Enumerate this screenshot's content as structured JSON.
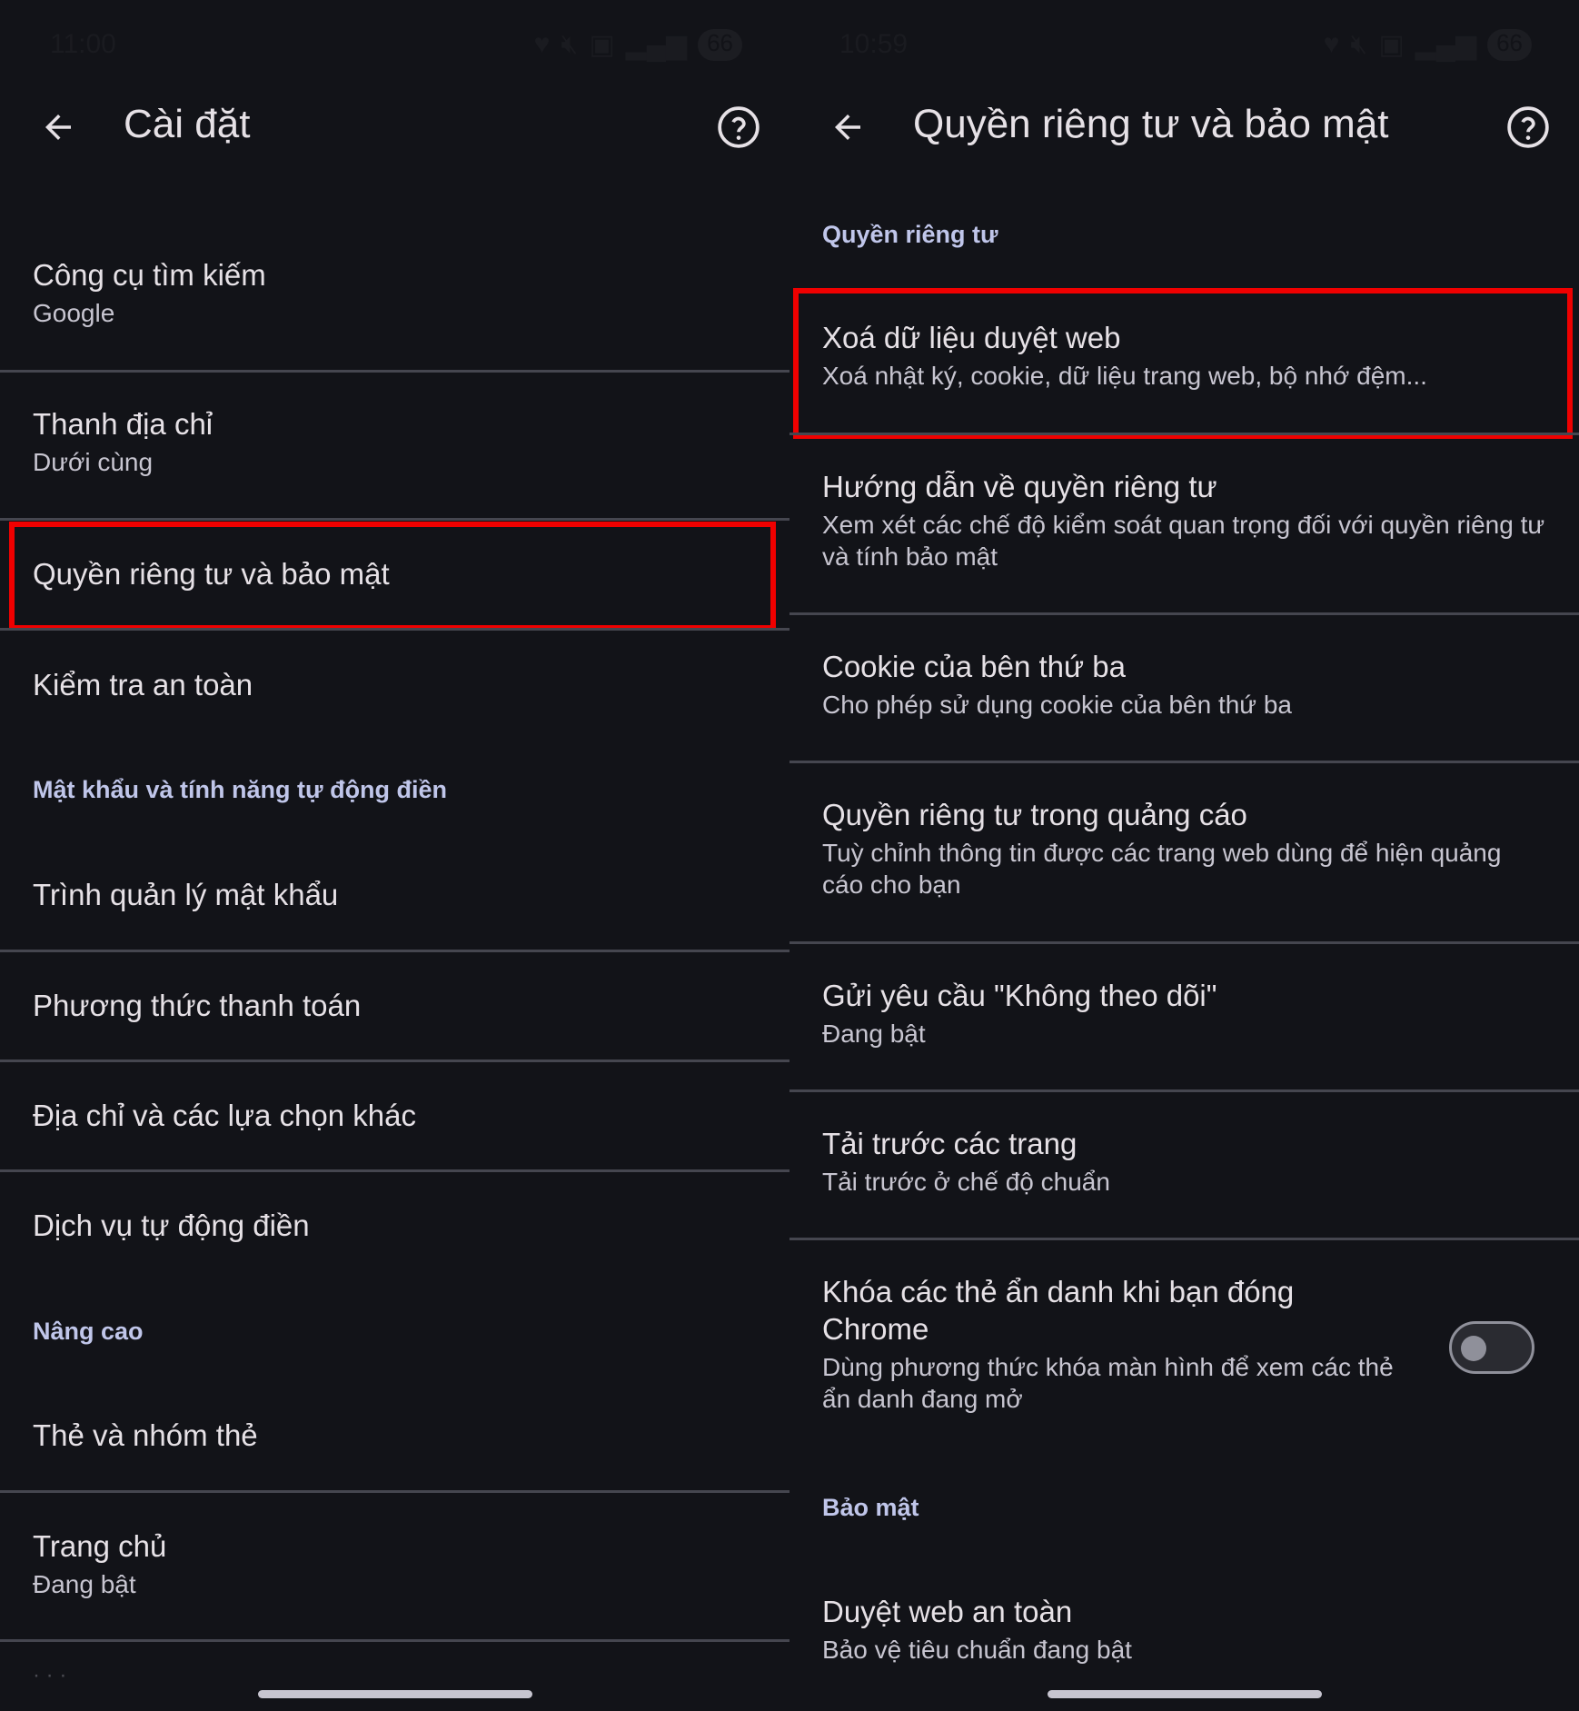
{
  "left": {
    "status": {
      "time": "11:00",
      "battery": "66"
    },
    "title": "Cài đặt",
    "items": [
      {
        "title": "Công cụ tìm kiếm",
        "subtitle": "Google"
      },
      {
        "title": "Thanh địa chỉ",
        "subtitle": "Dưới cùng"
      },
      {
        "title": "Quyền riêng tư và bảo mật"
      },
      {
        "title": "Kiểm tra an toàn"
      },
      {
        "title": "Trình quản lý mật khẩu"
      },
      {
        "title": "Phương thức thanh toán"
      },
      {
        "title": "Địa chỉ và các lựa chọn khác"
      },
      {
        "title": "Dịch vụ tự động điền"
      },
      {
        "title": "Thẻ và nhóm thẻ"
      },
      {
        "title": "Trang chủ",
        "subtitle": "Đang bật"
      }
    ],
    "sections": {
      "passwords": "Mật khẩu và tính năng tự động điền",
      "advanced": "Nâng cao"
    },
    "partial_text": "· ·  ·"
  },
  "right": {
    "status": {
      "time": "10:59",
      "battery": "66"
    },
    "title": "Quyền riêng tư và bảo mật",
    "sections": {
      "privacy": "Quyền riêng tư",
      "security": "Bảo mật"
    },
    "items": [
      {
        "title": "Xoá dữ liệu duyệt web",
        "subtitle": "Xoá nhật ký, cookie, dữ liệu trang web, bộ nhớ đệm..."
      },
      {
        "title": "Hướng dẫn về quyền riêng tư",
        "subtitle": "Xem xét các chế độ kiểm soát quan trọng đối với quyền riêng tư và tính bảo mật"
      },
      {
        "title": "Cookie của bên thứ ba",
        "subtitle": "Cho phép sử dụng cookie của bên thứ ba"
      },
      {
        "title": "Quyền riêng tư trong quảng cáo",
        "subtitle": "Tuỳ chỉnh thông tin được các trang web dùng để hiện quảng cáo cho bạn"
      },
      {
        "title": "Gửi yêu cầu \"Không theo dõi\"",
        "subtitle": "Đang bật"
      },
      {
        "title": "Tải trước các trang",
        "subtitle": "Tải trước ở chế độ chuẩn"
      },
      {
        "title": "Khóa các thẻ ẩn danh khi bạn đóng Chrome",
        "subtitle": "Dùng phương thức khóa màn hình để xem các thẻ ẩn danh đang mở",
        "toggle_on": false
      },
      {
        "title": "Duyệt web an toàn",
        "subtitle": "Bảo vệ tiêu chuẩn đang bật"
      }
    ]
  },
  "colors": {
    "background": "#121318",
    "highlight": "#f00000",
    "section_header": "#c0c6ea",
    "divider": "#45464f"
  },
  "icons": [
    "back-arrow-icon",
    "help-icon",
    "heart-icon",
    "mute-icon",
    "network-icon",
    "signal-icon"
  ]
}
